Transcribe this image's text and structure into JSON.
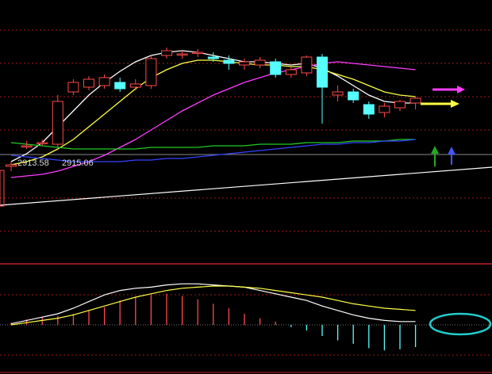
{
  "colors": {
    "background": "#000000",
    "up": "#ff4a4a",
    "down": "#55ffff",
    "grid": "#a01818",
    "ma_white": "#ffffff",
    "ma_yellow": "#ffff44",
    "ma_magenta": "#ff3cff",
    "ma_green": "#22cc22",
    "ma_blue": "#3344ff",
    "trend_line": "#ffffff",
    "divider": "#c02020",
    "highlight_ellipse": "#22cccc"
  },
  "price_labels": [
    "2913.58",
    "2915.06"
  ],
  "chart_data": [
    {
      "type": "candlestick",
      "panel": "price",
      "ylim": [
        2850,
        3000
      ],
      "candles": [
        {
          "i": 0,
          "o": 2905,
          "h": 2908,
          "l": 2902,
          "c": 2906
        },
        {
          "i": 1,
          "o": 2918,
          "h": 2921,
          "l": 2916,
          "c": 2918
        },
        {
          "i": 2,
          "o": 2920,
          "h": 2922,
          "l": 2918,
          "c": 2920
        },
        {
          "i": 3,
          "o": 2919,
          "h": 2950,
          "l": 2917,
          "c": 2946
        },
        {
          "i": 4,
          "o": 2952,
          "h": 2960,
          "l": 2950,
          "c": 2958
        },
        {
          "i": 5,
          "o": 2955,
          "h": 2962,
          "l": 2953,
          "c": 2960
        },
        {
          "i": 6,
          "o": 2956,
          "h": 2963,
          "l": 2954,
          "c": 2961
        },
        {
          "i": 7,
          "o": 2958,
          "h": 2961,
          "l": 2952,
          "c": 2954
        },
        {
          "i": 8,
          "o": 2955,
          "h": 2960,
          "l": 2953,
          "c": 2957
        },
        {
          "i": 9,
          "o": 2956,
          "h": 2975,
          "l": 2954,
          "c": 2973
        },
        {
          "i": 10,
          "o": 2975,
          "h": 2980,
          "l": 2973,
          "c": 2978
        },
        {
          "i": 11,
          "o": 2976,
          "h": 2978,
          "l": 2973,
          "c": 2976
        },
        {
          "i": 12,
          "o": 2977,
          "h": 2979,
          "l": 2974,
          "c": 2977
        },
        {
          "i": 13,
          "o": 2974,
          "h": 2977,
          "l": 2971,
          "c": 2973
        },
        {
          "i": 14,
          "o": 2972,
          "h": 2975,
          "l": 2966,
          "c": 2970
        },
        {
          "i": 15,
          "o": 2969,
          "h": 2973,
          "l": 2966,
          "c": 2971
        },
        {
          "i": 16,
          "o": 2969,
          "h": 2974,
          "l": 2967,
          "c": 2972
        },
        {
          "i": 17,
          "o": 2971,
          "h": 2973,
          "l": 2961,
          "c": 2963
        },
        {
          "i": 18,
          "o": 2963,
          "h": 2968,
          "l": 2961,
          "c": 2966
        },
        {
          "i": 19,
          "o": 2964,
          "h": 2975,
          "l": 2962,
          "c": 2974
        },
        {
          "i": 20,
          "o": 2974,
          "h": 2976,
          "l": 2932,
          "c": 2955
        },
        {
          "i": 21,
          "o": 2950,
          "h": 2956,
          "l": 2946,
          "c": 2952
        },
        {
          "i": 22,
          "o": 2952,
          "h": 2954,
          "l": 2945,
          "c": 2947
        },
        {
          "i": 23,
          "o": 2944,
          "h": 2946,
          "l": 2935,
          "c": 2938
        },
        {
          "i": 24,
          "o": 2939,
          "h": 2945,
          "l": 2936,
          "c": 2943
        },
        {
          "i": 25,
          "o": 2942,
          "h": 2947,
          "l": 2940,
          "c": 2946
        },
        {
          "i": 26,
          "o": 2945,
          "h": 2949,
          "l": 2941,
          "c": 2948
        }
      ],
      "moving_averages": [
        {
          "color_key": "ma_white",
          "points": [
            [
              0,
              2908
            ],
            [
              1,
              2913
            ],
            [
              2,
              2920
            ],
            [
              3,
              2930
            ],
            [
              4,
              2940
            ],
            [
              5,
              2950
            ],
            [
              6,
              2958
            ],
            [
              7,
              2965
            ],
            [
              8,
              2971
            ],
            [
              9,
              2975
            ],
            [
              10,
              2977
            ],
            [
              11,
              2978
            ],
            [
              12,
              2977
            ],
            [
              13,
              2975
            ],
            [
              14,
              2973
            ],
            [
              15,
              2971
            ],
            [
              16,
              2971
            ],
            [
              17,
              2970
            ],
            [
              18,
              2969
            ],
            [
              19,
              2970
            ],
            [
              20,
              2967
            ],
            [
              21,
              2962
            ],
            [
              22,
              2956
            ],
            [
              23,
              2950
            ],
            [
              24,
              2946
            ],
            [
              25,
              2945
            ],
            [
              26,
              2945
            ]
          ]
        },
        {
          "color_key": "ma_yellow",
          "points": [
            [
              0,
              2906
            ],
            [
              1,
              2908
            ],
            [
              2,
              2911
            ],
            [
              3,
              2916
            ],
            [
              4,
              2922
            ],
            [
              5,
              2930
            ],
            [
              6,
              2938
            ],
            [
              7,
              2946
            ],
            [
              8,
              2954
            ],
            [
              9,
              2961
            ],
            [
              10,
              2966
            ],
            [
              11,
              2970
            ],
            [
              12,
              2972
            ],
            [
              13,
              2972
            ],
            [
              14,
              2971
            ],
            [
              15,
              2970
            ],
            [
              16,
              2969
            ],
            [
              17,
              2969
            ],
            [
              18,
              2968
            ],
            [
              19,
              2968
            ],
            [
              20,
              2966
            ],
            [
              21,
              2963
            ],
            [
              22,
              2960
            ],
            [
              23,
              2956
            ],
            [
              24,
              2952
            ],
            [
              25,
              2950
            ],
            [
              26,
              2949
            ]
          ]
        },
        {
          "color_key": "ma_magenta",
          "points": [
            [
              0,
              2898
            ],
            [
              1,
              2899
            ],
            [
              2,
              2900
            ],
            [
              3,
              2902
            ],
            [
              4,
              2905
            ],
            [
              5,
              2908
            ],
            [
              6,
              2912
            ],
            [
              7,
              2917
            ],
            [
              8,
              2922
            ],
            [
              9,
              2928
            ],
            [
              10,
              2934
            ],
            [
              11,
              2940
            ],
            [
              12,
              2945
            ],
            [
              13,
              2950
            ],
            [
              14,
              2954
            ],
            [
              15,
              2958
            ],
            [
              16,
              2961
            ],
            [
              17,
              2964
            ],
            [
              18,
              2966
            ],
            [
              19,
              2968
            ],
            [
              20,
              2970
            ],
            [
              21,
              2971
            ],
            [
              22,
              2970
            ],
            [
              23,
              2969
            ],
            [
              24,
              2968
            ],
            [
              25,
              2967
            ],
            [
              26,
              2966
            ]
          ]
        },
        {
          "color_key": "ma_green",
          "points": [
            [
              0,
              2920
            ],
            [
              1,
              2919
            ],
            [
              2,
              2918
            ],
            [
              3,
              2917
            ],
            [
              4,
              2916
            ],
            [
              5,
              2916
            ],
            [
              6,
              2916
            ],
            [
              7,
              2916
            ],
            [
              8,
              2916
            ],
            [
              9,
              2917
            ],
            [
              10,
              2917
            ],
            [
              11,
              2917
            ],
            [
              12,
              2917
            ],
            [
              13,
              2918
            ],
            [
              14,
              2918
            ],
            [
              15,
              2918
            ],
            [
              16,
              2919
            ],
            [
              17,
              2919
            ],
            [
              18,
              2919
            ],
            [
              19,
              2920
            ],
            [
              20,
              2920
            ],
            [
              21,
              2920
            ],
            [
              22,
              2921
            ],
            [
              23,
              2921
            ],
            [
              24,
              2921
            ],
            [
              25,
              2922
            ],
            [
              26,
              2922
            ]
          ]
        },
        {
          "color_key": "ma_blue",
          "points": [
            [
              0,
              2912
            ],
            [
              1,
              2911
            ],
            [
              2,
              2910
            ],
            [
              3,
              2909
            ],
            [
              4,
              2908
            ],
            [
              5,
              2908
            ],
            [
              6,
              2908
            ],
            [
              7,
              2908
            ],
            [
              8,
              2909
            ],
            [
              9,
              2909
            ],
            [
              10,
              2910
            ],
            [
              11,
              2910
            ],
            [
              12,
              2911
            ],
            [
              13,
              2912
            ],
            [
              14,
              2913
            ],
            [
              15,
              2914
            ],
            [
              16,
              2915
            ],
            [
              17,
              2916
            ],
            [
              18,
              2917
            ],
            [
              19,
              2918
            ],
            [
              20,
              2919
            ],
            [
              21,
              2919
            ],
            [
              22,
              2920
            ],
            [
              23,
              2920
            ],
            [
              24,
              2921
            ],
            [
              25,
              2921
            ],
            [
              26,
              2922
            ]
          ]
        }
      ]
    },
    {
      "type": "histogram",
      "panel": "macd",
      "ylim": [
        -30,
        50
      ],
      "bars": [
        2,
        5,
        7,
        8,
        10,
        13,
        16,
        22,
        25,
        27,
        28,
        26,
        23,
        19,
        15,
        10,
        6,
        3,
        -2,
        -5,
        -10,
        -14,
        -17,
        -21,
        -23,
        -22,
        -20
      ],
      "lines": [
        {
          "color_key": "ma_white",
          "values": [
            1,
            4,
            7,
            10,
            15,
            21,
            27,
            31,
            33,
            34,
            36,
            37,
            37,
            36,
            35,
            34,
            31,
            28,
            25,
            22,
            17,
            13,
            9,
            6,
            4,
            3,
            3
          ]
        },
        {
          "color_key": "ma_yellow",
          "values": [
            0,
            2,
            4,
            6,
            9,
            13,
            17,
            21,
            25,
            28,
            31,
            33,
            34,
            35,
            35,
            34,
            33,
            31,
            29,
            27,
            25,
            22,
            19,
            17,
            15,
            14,
            13
          ]
        }
      ]
    }
  ]
}
